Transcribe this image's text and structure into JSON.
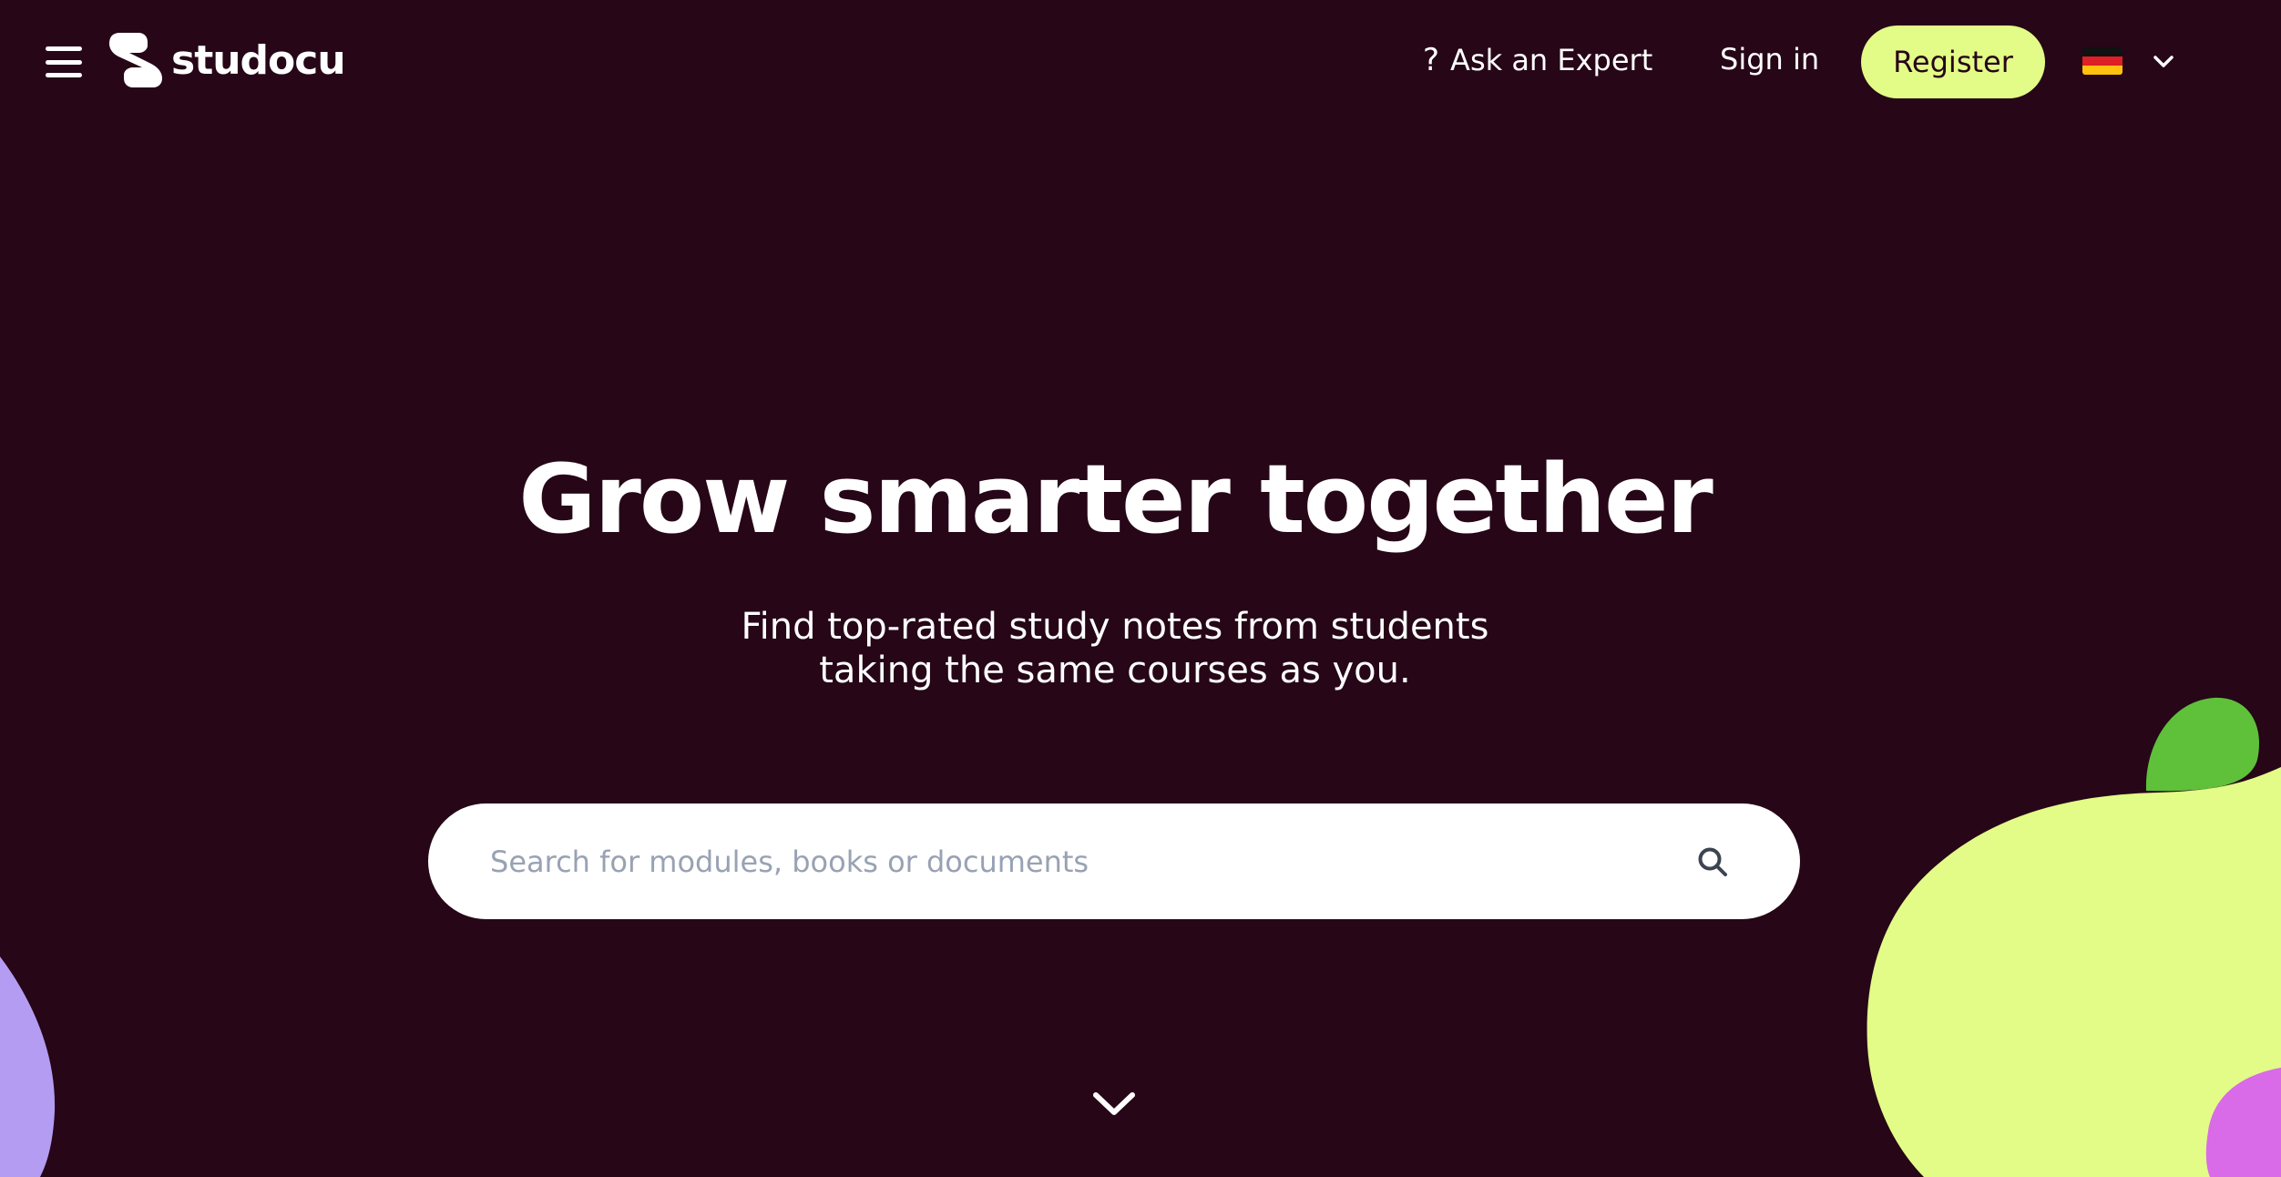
{
  "header": {
    "menu_icon": "hamburger-menu-icon",
    "logo_text": "studocu",
    "ask_expert": {
      "icon": "question-mark-icon",
      "icon_glyph": "?",
      "label": "Ask an Expert"
    },
    "sign_in_label": "Sign in",
    "register_label": "Register",
    "language": {
      "flag_icon": "germany-flag-icon",
      "chevron_icon": "chevron-down-icon"
    }
  },
  "hero": {
    "title": "Grow smarter together",
    "subtitle_line1": "Find top-rated study notes from students",
    "subtitle_line2": "taking the same courses as you."
  },
  "search": {
    "placeholder": "Search for modules, books or documents",
    "value": "",
    "icon": "search-icon"
  },
  "scroll_down_icon": "chevron-down-icon",
  "colors": {
    "background": "#260617",
    "accent_register": "#e3fc87",
    "blob_yellow": "#e3fc87",
    "blob_green": "#5fc03a",
    "blob_purple": "#b49cf2",
    "blob_pink": "#d96ae8",
    "text_primary": "#ffffff",
    "placeholder": "#98a2b3"
  }
}
